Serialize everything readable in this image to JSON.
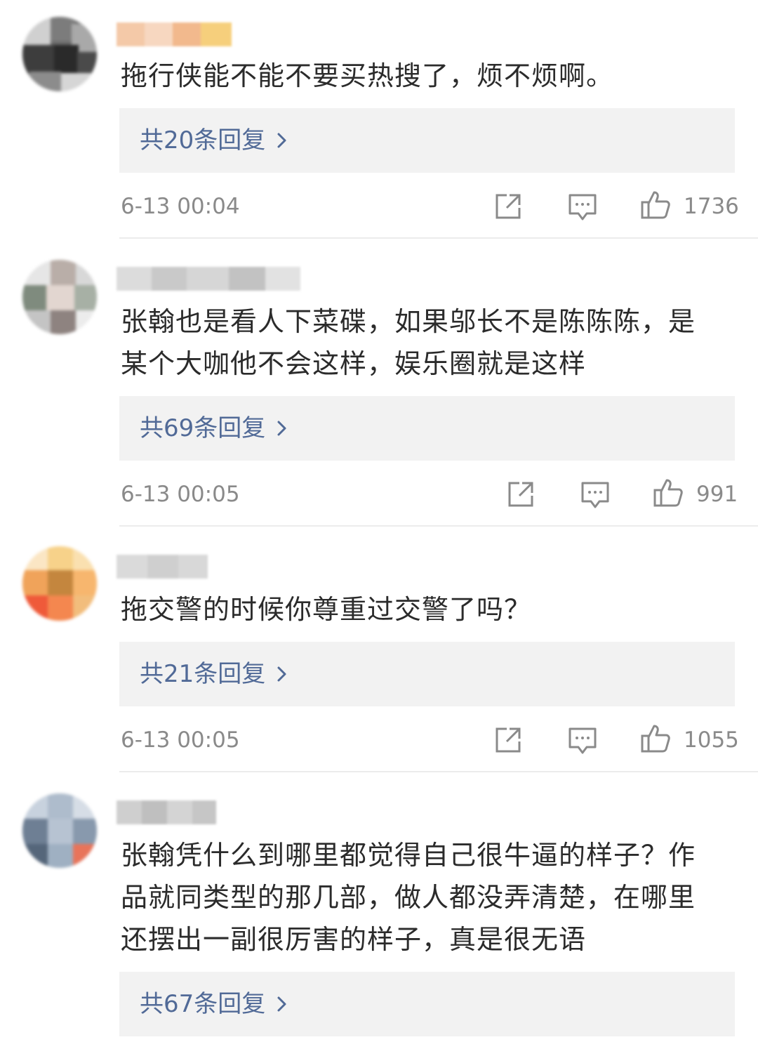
{
  "comments": [
    {
      "text_lines": [
        "拖行侠能不能不要买热搜了，烦不烦啊。"
      ],
      "replies": "共20条回复",
      "time": "6-13 00:04",
      "likes": "1736"
    },
    {
      "text_lines": [
        "张翰也是看人下菜碟，如果邬长不是陈陈陈，是",
        "某个大咖他不会这样，娱乐圈就是这样"
      ],
      "replies": "共69条回复",
      "time": "6-13 00:05",
      "likes": "991"
    },
    {
      "text_lines": [
        "拖交警的时候你尊重过交警了吗？"
      ],
      "replies": "共21条回复",
      "time": "6-13 00:05",
      "likes": "1055"
    },
    {
      "text_lines": [
        "张翰凭什么到哪里都觉得自己很牛逼的样子？作",
        "品就同类型的那几部，做人都没弄清楚，在哪里",
        "还摆出一副很厉害的样子，真是很无语"
      ],
      "replies": "共67条回复"
    }
  ],
  "icons": {
    "share": "share-icon",
    "comment": "comment-icon",
    "like": "thumbs-up-icon",
    "chevron": "chevron-right-icon"
  },
  "colors": {
    "link": "#516a97",
    "reply_bg": "#f2f2f2",
    "meta": "#8a8a8a",
    "text": "#2b2b2b"
  }
}
